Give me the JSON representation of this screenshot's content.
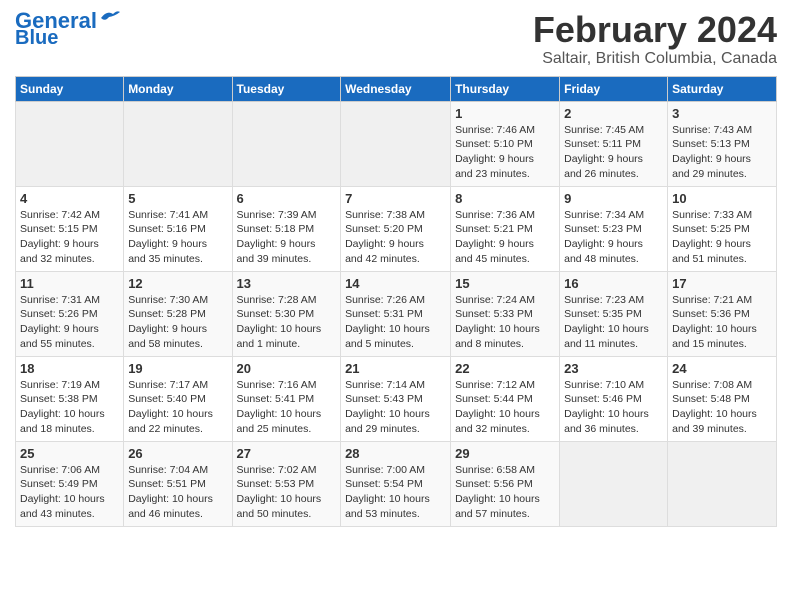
{
  "logo": {
    "line1": "General",
    "line2": "Blue"
  },
  "title": "February 2024",
  "subtitle": "Saltair, British Columbia, Canada",
  "days_of_week": [
    "Sunday",
    "Monday",
    "Tuesday",
    "Wednesday",
    "Thursday",
    "Friday",
    "Saturday"
  ],
  "weeks": [
    [
      {
        "day": "",
        "info": ""
      },
      {
        "day": "",
        "info": ""
      },
      {
        "day": "",
        "info": ""
      },
      {
        "day": "",
        "info": ""
      },
      {
        "day": "1",
        "info": "Sunrise: 7:46 AM\nSunset: 5:10 PM\nDaylight: 9 hours\nand 23 minutes."
      },
      {
        "day": "2",
        "info": "Sunrise: 7:45 AM\nSunset: 5:11 PM\nDaylight: 9 hours\nand 26 minutes."
      },
      {
        "day": "3",
        "info": "Sunrise: 7:43 AM\nSunset: 5:13 PM\nDaylight: 9 hours\nand 29 minutes."
      }
    ],
    [
      {
        "day": "4",
        "info": "Sunrise: 7:42 AM\nSunset: 5:15 PM\nDaylight: 9 hours\nand 32 minutes."
      },
      {
        "day": "5",
        "info": "Sunrise: 7:41 AM\nSunset: 5:16 PM\nDaylight: 9 hours\nand 35 minutes."
      },
      {
        "day": "6",
        "info": "Sunrise: 7:39 AM\nSunset: 5:18 PM\nDaylight: 9 hours\nand 39 minutes."
      },
      {
        "day": "7",
        "info": "Sunrise: 7:38 AM\nSunset: 5:20 PM\nDaylight: 9 hours\nand 42 minutes."
      },
      {
        "day": "8",
        "info": "Sunrise: 7:36 AM\nSunset: 5:21 PM\nDaylight: 9 hours\nand 45 minutes."
      },
      {
        "day": "9",
        "info": "Sunrise: 7:34 AM\nSunset: 5:23 PM\nDaylight: 9 hours\nand 48 minutes."
      },
      {
        "day": "10",
        "info": "Sunrise: 7:33 AM\nSunset: 5:25 PM\nDaylight: 9 hours\nand 51 minutes."
      }
    ],
    [
      {
        "day": "11",
        "info": "Sunrise: 7:31 AM\nSunset: 5:26 PM\nDaylight: 9 hours\nand 55 minutes."
      },
      {
        "day": "12",
        "info": "Sunrise: 7:30 AM\nSunset: 5:28 PM\nDaylight: 9 hours\nand 58 minutes."
      },
      {
        "day": "13",
        "info": "Sunrise: 7:28 AM\nSunset: 5:30 PM\nDaylight: 10 hours\nand 1 minute."
      },
      {
        "day": "14",
        "info": "Sunrise: 7:26 AM\nSunset: 5:31 PM\nDaylight: 10 hours\nand 5 minutes."
      },
      {
        "day": "15",
        "info": "Sunrise: 7:24 AM\nSunset: 5:33 PM\nDaylight: 10 hours\nand 8 minutes."
      },
      {
        "day": "16",
        "info": "Sunrise: 7:23 AM\nSunset: 5:35 PM\nDaylight: 10 hours\nand 11 minutes."
      },
      {
        "day": "17",
        "info": "Sunrise: 7:21 AM\nSunset: 5:36 PM\nDaylight: 10 hours\nand 15 minutes."
      }
    ],
    [
      {
        "day": "18",
        "info": "Sunrise: 7:19 AM\nSunset: 5:38 PM\nDaylight: 10 hours\nand 18 minutes."
      },
      {
        "day": "19",
        "info": "Sunrise: 7:17 AM\nSunset: 5:40 PM\nDaylight: 10 hours\nand 22 minutes."
      },
      {
        "day": "20",
        "info": "Sunrise: 7:16 AM\nSunset: 5:41 PM\nDaylight: 10 hours\nand 25 minutes."
      },
      {
        "day": "21",
        "info": "Sunrise: 7:14 AM\nSunset: 5:43 PM\nDaylight: 10 hours\nand 29 minutes."
      },
      {
        "day": "22",
        "info": "Sunrise: 7:12 AM\nSunset: 5:44 PM\nDaylight: 10 hours\nand 32 minutes."
      },
      {
        "day": "23",
        "info": "Sunrise: 7:10 AM\nSunset: 5:46 PM\nDaylight: 10 hours\nand 36 minutes."
      },
      {
        "day": "24",
        "info": "Sunrise: 7:08 AM\nSunset: 5:48 PM\nDaylight: 10 hours\nand 39 minutes."
      }
    ],
    [
      {
        "day": "25",
        "info": "Sunrise: 7:06 AM\nSunset: 5:49 PM\nDaylight: 10 hours\nand 43 minutes."
      },
      {
        "day": "26",
        "info": "Sunrise: 7:04 AM\nSunset: 5:51 PM\nDaylight: 10 hours\nand 46 minutes."
      },
      {
        "day": "27",
        "info": "Sunrise: 7:02 AM\nSunset: 5:53 PM\nDaylight: 10 hours\nand 50 minutes."
      },
      {
        "day": "28",
        "info": "Sunrise: 7:00 AM\nSunset: 5:54 PM\nDaylight: 10 hours\nand 53 minutes."
      },
      {
        "day": "29",
        "info": "Sunrise: 6:58 AM\nSunset: 5:56 PM\nDaylight: 10 hours\nand 57 minutes."
      },
      {
        "day": "",
        "info": ""
      },
      {
        "day": "",
        "info": ""
      }
    ]
  ]
}
